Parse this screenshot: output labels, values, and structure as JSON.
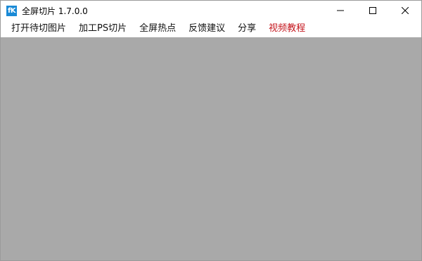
{
  "app": {
    "icon_text": "fK",
    "title": "全屏切片 1.7.0.0"
  },
  "menu": {
    "items": [
      {
        "label": "打开待切图片",
        "color": "#111111"
      },
      {
        "label": "加工PS切片",
        "color": "#111111"
      },
      {
        "label": "全屏热点",
        "color": "#111111"
      },
      {
        "label": "反馈建议",
        "color": "#111111"
      },
      {
        "label": "分享",
        "color": "#111111"
      },
      {
        "label": "视频教程",
        "color": "#c4151c"
      }
    ]
  },
  "colors": {
    "content_background": "#a9a9a9",
    "icon_background": "#1a8ad6"
  }
}
